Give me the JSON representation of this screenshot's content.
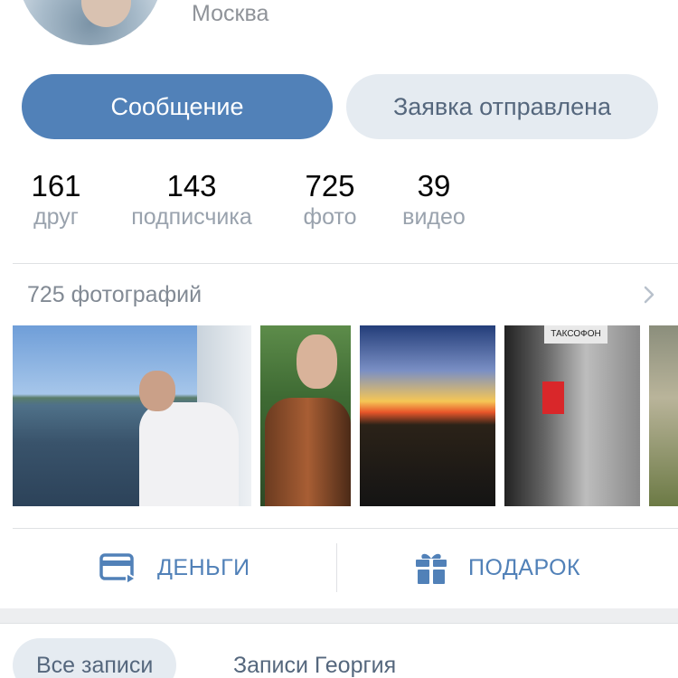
{
  "profile": {
    "city": "Москва"
  },
  "buttons": {
    "message": "Сообщение",
    "request_sent": "Заявка отправлена"
  },
  "stats": [
    {
      "value": "161",
      "label": "друг"
    },
    {
      "value": "143",
      "label": "подписчика"
    },
    {
      "value": "725",
      "label": "фото"
    },
    {
      "value": "39",
      "label": "видео"
    }
  ],
  "photos": {
    "header": "725 фотографий",
    "booth_sign": "ТАКСОФОН"
  },
  "actions": {
    "money": "ДЕНЬГИ",
    "gift": "ПОДАРОК"
  },
  "tabs": {
    "all_posts": "Все записи",
    "user_posts": "Записи Георгия"
  },
  "colors": {
    "accent": "#5181b8",
    "secondary_button_bg": "#e5ebf1",
    "secondary_text": "#99a2ad"
  }
}
